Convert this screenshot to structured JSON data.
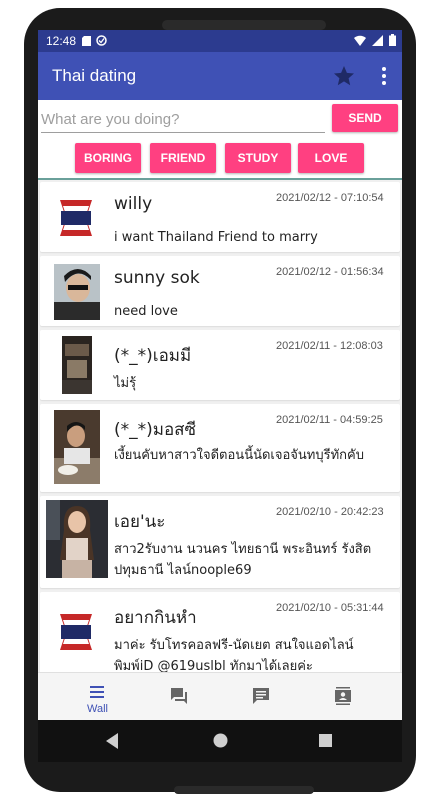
{
  "status_bar": {
    "time": "12:48"
  },
  "app_bar": {
    "title": "Thai dating"
  },
  "composer": {
    "placeholder": "What are you doing?",
    "value": "",
    "send_label": "SEND"
  },
  "mood_chips": [
    "BORING",
    "FRIEND",
    "STUDY",
    "LOVE"
  ],
  "posts": [
    {
      "name": "willy",
      "date": "2021/02/12 - 07:10:54",
      "message": "i want Thailand Friend to marry",
      "avatar": "flag"
    },
    {
      "name": "sunny sok",
      "date": "2021/02/12 - 01:56:34",
      "message": "need love",
      "avatar": "photo"
    },
    {
      "name": "(*_*)เอมมี",
      "date": "2021/02/11 - 12:08:03",
      "message": "ไม่รุ้",
      "avatar": "photo"
    },
    {
      "name": "(*_*)มอสซี",
      "date": "2021/02/11 - 04:59:25",
      "message": "เงี้ยนคับหาสาวใจดีตอนนี้นัดเจอจันทบุรีทักคับ",
      "avatar": "photo"
    },
    {
      "name": "เอย'นะ",
      "date": "2021/02/10 - 20:42:23",
      "message": "สาว2รับงาน นวนคร ไทยธานี พระอินทร์ รังสิต ปทุมธานี ไลน์noople69",
      "avatar": "photo"
    },
    {
      "name": "อยากกินหำ",
      "date": "2021/02/10 - 05:31:44",
      "message": "มาค่ะ รับโทรคอลฟรี-นัดเยต สนใจแอดไลน์ พิมพ์iD @619uslbl ทักมาได้เลยค่ะ",
      "avatar": "flag"
    }
  ],
  "bottom_nav": {
    "wall_label": "Wall"
  },
  "colors": {
    "primary": "#3f51b5",
    "primary_dark": "#2c3b8f",
    "accent": "#ff4081"
  }
}
